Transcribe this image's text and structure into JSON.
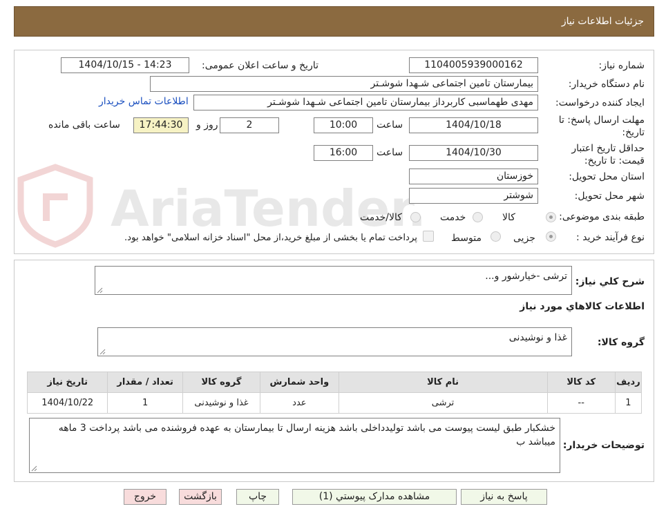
{
  "header": {
    "title": "جزئیات اطلاعات نیاز"
  },
  "watermark": {
    "text": "AriaTender.neT"
  },
  "fields": {
    "need_number_label": "شماره نیاز:",
    "need_number": "1104005939000162",
    "announce_label": "تاریخ و ساعت اعلان عمومی:",
    "announce_value": "1404/10/15 - 14:23",
    "buyer_org_label": "نام دستگاه خریدار:",
    "buyer_org": "بیمارستان تامین اجتماعی شـهدا شوشـتر",
    "creator_label": "ایجاد کننده درخواست:",
    "creator": "مهدی طهماسبی کاربرداز بیمارستان تامین اجتماعی شـهدا شوشـتر",
    "contact_link": "اطلاعات تماس خریدار",
    "deadline_label": "مهلت ارسال پاسخ: تا تاریخ:",
    "deadline_date": "1404/10/18",
    "time_label": "ساعت",
    "deadline_time": "10:00",
    "days_value": "2",
    "days_label": "روز و",
    "remaining_time": "17:44:30",
    "remaining_label": "ساعت باقی مانده",
    "validity_label": "حداقل تاریخ اعتبار قیمت: تا تاریخ:",
    "validity_date": "1404/10/30",
    "validity_time": "16:00",
    "province_label": "استان محل تحویل:",
    "province": "خوزستان",
    "city_label": "شهر محل تحویل:",
    "city": "شوشتر",
    "category_label": "طبقه بندی موضوعی:",
    "category_options": [
      "کالا",
      "خدمت",
      "کالا/خدمت"
    ],
    "process_label": "نوع فرآیند خرید :",
    "process_options": [
      "جزیی",
      "متوسط"
    ],
    "payment_note": "پرداخت تمام یا بخشی از مبلغ خرید،از محل \"اسناد خزانه اسلامی\" خواهد بود."
  },
  "description": {
    "label": "شرح کلي نياز:",
    "value": "ترشی -خیارشور و..."
  },
  "goods_info_title": "اطلاعات کالاهاي مورد نياز",
  "goods_group": {
    "label": "گروه کالا:",
    "value": "غذا و نوشیدنی"
  },
  "table": {
    "headers": [
      "رديف",
      "کد کالا",
      "نام کالا",
      "واحد شمارش",
      "گروه کالا",
      "تعداد / مقدار",
      "تاريخ نياز"
    ],
    "rows": [
      [
        "1",
        "--",
        "ترشی",
        "عدد",
        "غذا و نوشیدنی",
        "1",
        "1404/10/22"
      ]
    ]
  },
  "buyer_notes": {
    "label": "توضیحات خریدار:",
    "value": "خشکبار طبق لیست پیوست می باشد تولیدداخلی باشد هزینه ارسال تا بیمارستان به عهده فروشنده می باشد پرداخت 3 ماهه میباشد ب"
  },
  "buttons": {
    "reply": "پاسخ به نیاز",
    "attachments": "مشاهده مدارک پیوستي (1)",
    "print": "چاپ",
    "back": "بازگشت",
    "exit": "خروج"
  },
  "colors": {
    "header_bg": "#8b6a40",
    "link": "#1a4fbf",
    "remaining_bg": "#f6f2c4"
  }
}
